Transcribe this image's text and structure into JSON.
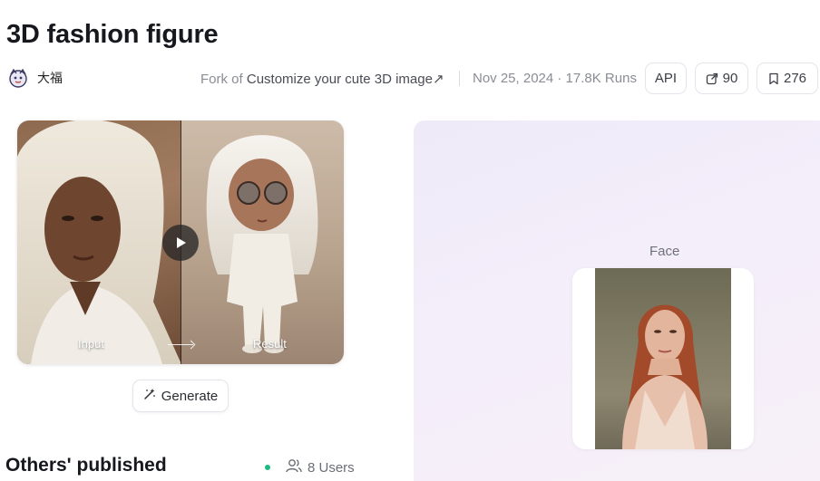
{
  "page": {
    "title": "3D fashion figure"
  },
  "author": {
    "name": "大福",
    "avatar_icon": "cartoon-avatar-icon"
  },
  "fork": {
    "prefix": "Fork of",
    "link_text": "Customize your cute 3D image",
    "link_icon": "↗"
  },
  "meta": {
    "date_runs": "Nov 25, 2024 · 17.8K Runs"
  },
  "actions": {
    "api_label": "API",
    "share_count": "90",
    "bookmark_count": "276"
  },
  "preview": {
    "input_label": "Input",
    "result_label": "Result",
    "play_icon": "play-icon"
  },
  "generate": {
    "label": "Generate",
    "icon": "magic-wand-icon"
  },
  "others": {
    "title": "Others' published",
    "users_label": "8 Users",
    "status_color": "#1fb981"
  },
  "face_input": {
    "label": "Face"
  }
}
